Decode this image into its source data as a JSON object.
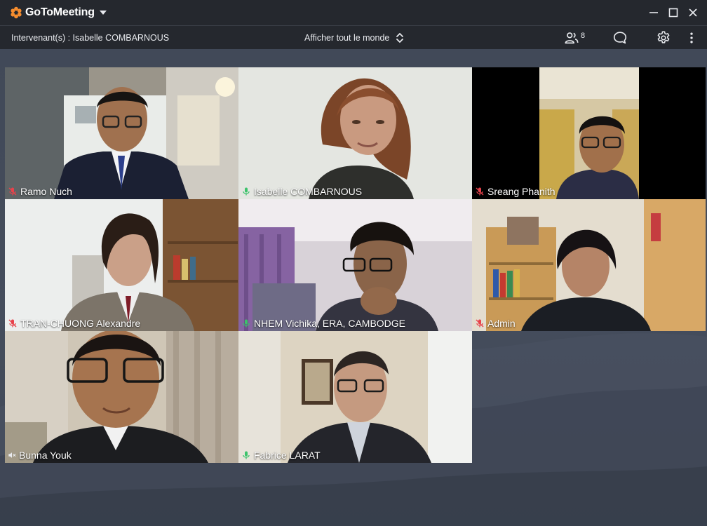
{
  "app": {
    "name": "GoToMeeting",
    "logo_color": "#f68d2e"
  },
  "toolbar": {
    "speaker_label": "Intervenant(s) : Isabelle COMBARNOUS",
    "view_label": "Afficher tout le monde",
    "attendee_count": "8"
  },
  "icons": {
    "window_controls": [
      "minimize-icon",
      "maximize-icon",
      "close-icon"
    ],
    "toolbar": [
      "people-icon",
      "chat-bubble-icon",
      "gear-icon",
      "kebab-menu-icon"
    ],
    "mic_on": "microphone-icon",
    "mic_muted": "microphone-muted-icon",
    "speaker_muted": "speaker-muted-icon"
  },
  "colors": {
    "mic_on": "#3cc36b",
    "mic_muted": "#e8424b",
    "stage_background": "#454d5c"
  },
  "participants": [
    {
      "name": "Ramo Nuch",
      "audio": "mic-muted"
    },
    {
      "name": "Isabelle COMBARNOUS",
      "audio": "mic-on"
    },
    {
      "name": "Sreang Phanith",
      "audio": "mic-muted"
    },
    {
      "name": "TRAN-CHUONG Alexandre",
      "audio": "mic-muted"
    },
    {
      "name": "NHEM Vichika, ERA, CAMBODGE",
      "audio": "mic-on"
    },
    {
      "name": "Admin",
      "audio": "mic-muted"
    },
    {
      "name": "Bunna Youk",
      "audio": "speaker-muted"
    },
    {
      "name": "Fabrice LARAT",
      "audio": "mic-on"
    }
  ]
}
